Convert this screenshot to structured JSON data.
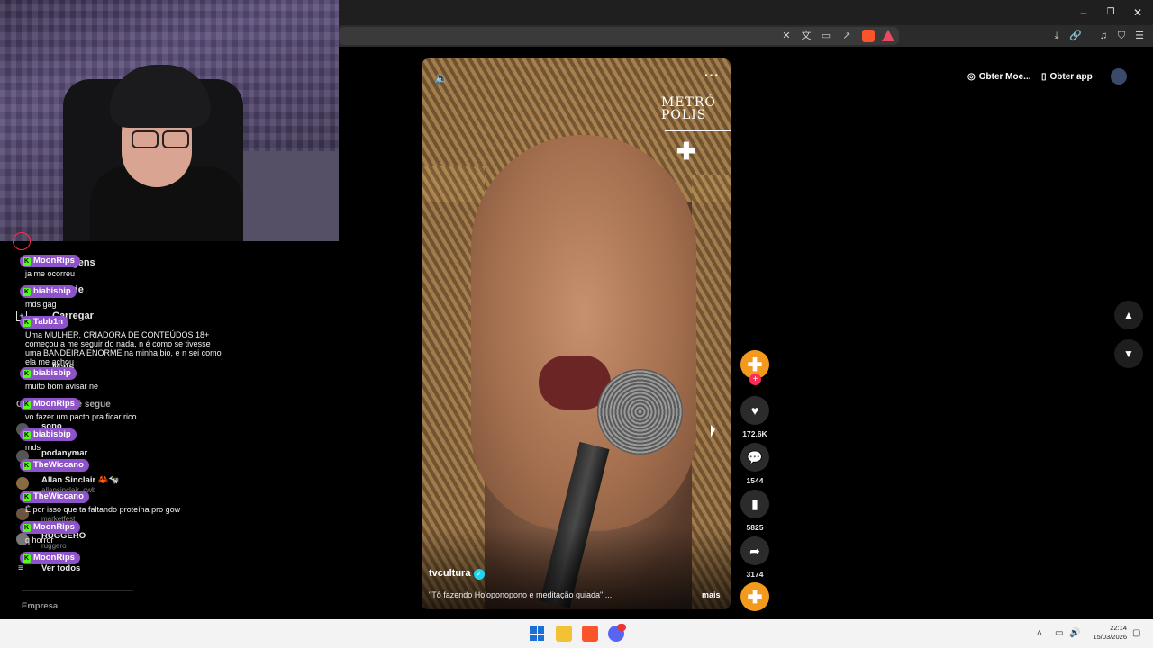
{
  "browser": {
    "window_controls": [
      "–",
      "❐",
      "✕"
    ]
  },
  "sidebar": {
    "partial_labels": [
      "gens",
      "de",
      "Carregar",
      "Mais",
      "cê segue"
    ],
    "following": [
      {
        "name": "sono"
      },
      {
        "name": "podanymar"
      },
      {
        "name": "Allan Sinclair 🦀🐄",
        "sub": "allansinclair_cwb"
      },
      {
        "name": "",
        "sub": "marketfest"
      },
      {
        "name": "RUGGERO",
        "sub": "ruggero"
      }
    ],
    "see_all": "Ver todos",
    "footer": "Empresa"
  },
  "chat": [
    {
      "user": "MoonRips",
      "text": "ja me ocorreu"
    },
    {
      "user": "biabisbip",
      "text": "mds gag"
    },
    {
      "user": "Tabb1n",
      "text": "Uma MULHER, CRIADORA DE CONTEÚDOS 18+ começou a me seguir do nada, n é como se tivesse uma BANDEIRA ENORME na minha bio, e n sei como ela me achou"
    },
    {
      "user": "biabisbip",
      "text": "muito bom avisar ne"
    },
    {
      "user": "MoonRips",
      "text": "vo fazer um pacto pra ficar rico"
    },
    {
      "user": "biabisbip",
      "text": "mds"
    },
    {
      "user": "TheWiccano",
      "text": ""
    },
    {
      "user": "TheWiccano",
      "text": "É por isso que ta faltando proteína pro gow"
    },
    {
      "user": "MoonRips",
      "text": "q horror"
    },
    {
      "user": "MoonRips",
      "text": ""
    }
  ],
  "video": {
    "watermark_line1": "METRÓ",
    "watermark_line2": "POLIS",
    "author": "tvcultura",
    "caption": "\"Tô fazendo Ho'oponopono e meditação guiada\" ...",
    "more_label": "mais",
    "icons": {
      "mute": "speaker-icon",
      "menu": "more-icon"
    }
  },
  "actions": {
    "likes": "172.6K",
    "comments": "1544",
    "saves": "5825",
    "shares": "3174"
  },
  "header_buttons": {
    "coins": "Obter Moe...",
    "app": "Obter app"
  },
  "taskbar": {
    "time": "22:14",
    "date": "15/03/2026"
  },
  "colors": {
    "chat_badge": "#8e52c9",
    "kick_green": "#53fc18",
    "creator_orange": "#f39a1e",
    "follow_red": "#fe2c55"
  }
}
